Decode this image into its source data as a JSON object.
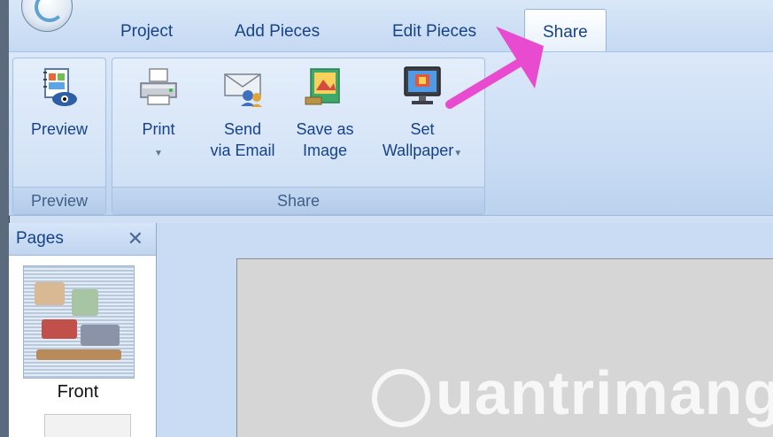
{
  "tabs": {
    "project": "Project",
    "add_pieces": "Add Pieces",
    "edit_pieces": "Edit Pieces",
    "share": "Share"
  },
  "ribbon": {
    "preview_group": {
      "label": "Preview",
      "preview_button": "Preview"
    },
    "share_group": {
      "label": "Share",
      "print_button": "Print",
      "send_email_line1": "Send",
      "send_email_line2": "via Email",
      "save_image_line1": "Save as",
      "save_image_line2": "Image",
      "wallpaper_line1": "Set",
      "wallpaper_line2": "Wallpaper"
    }
  },
  "pages_pane": {
    "title": "Pages",
    "close_symbol": "✕",
    "thumb_label": "Front"
  },
  "watermark": "uantrimang",
  "colors": {
    "accent_text": "#15428b",
    "annotation_arrow": "#e84ad0"
  }
}
